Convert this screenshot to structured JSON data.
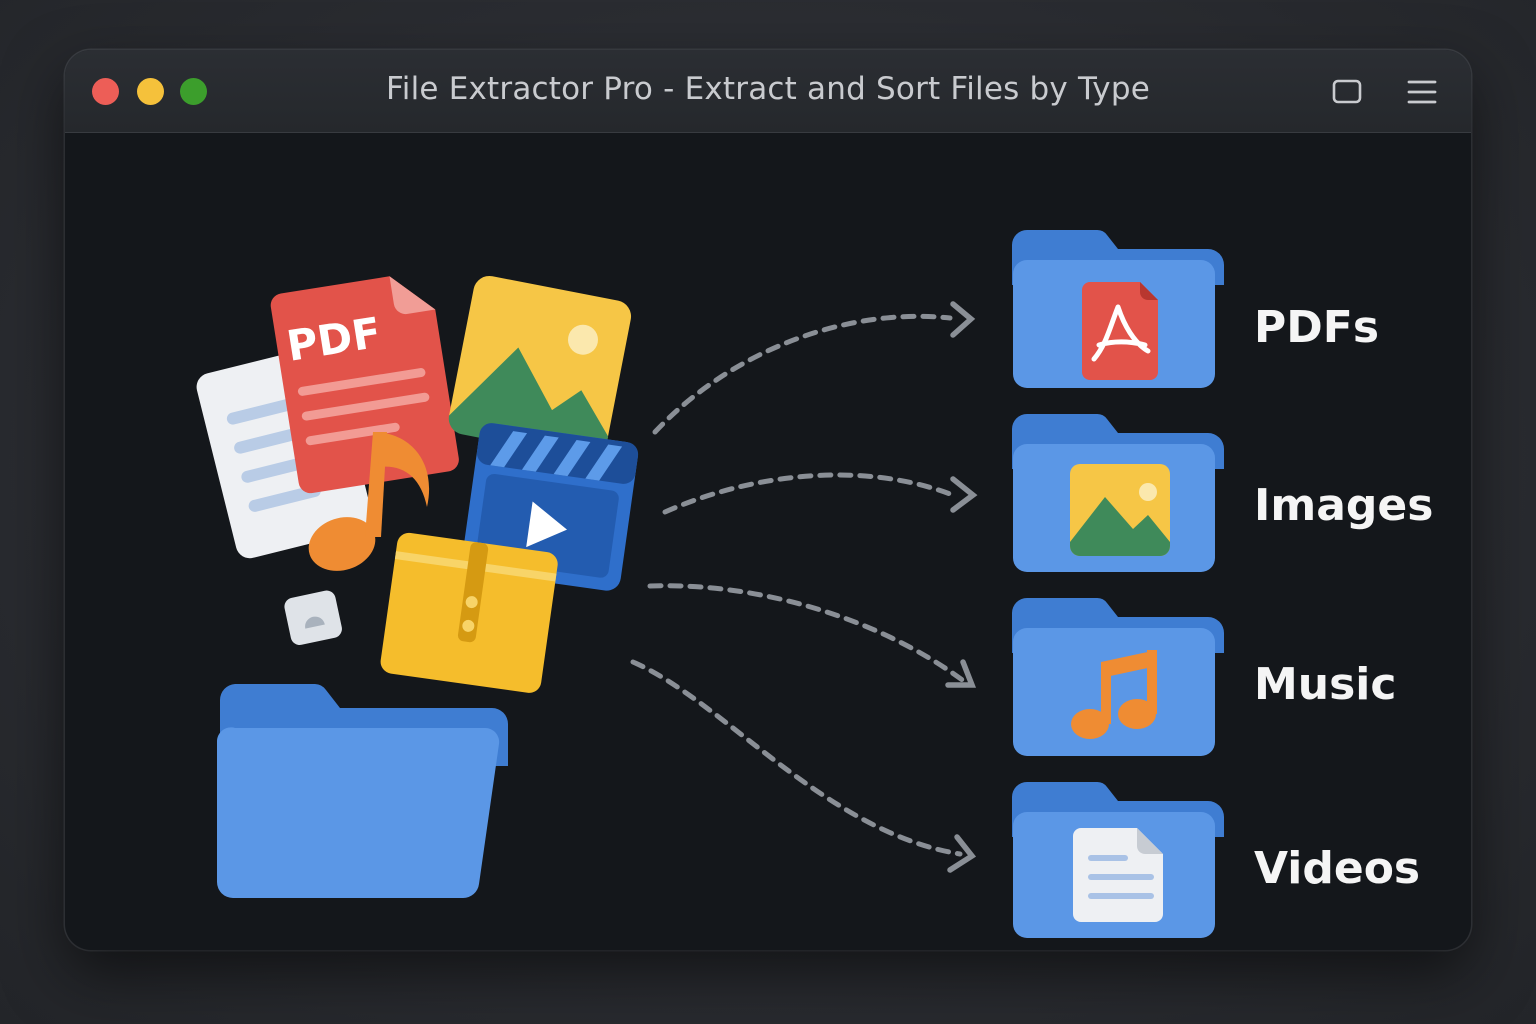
{
  "window": {
    "title": "File Extractor Pro - Extract and Sort Files by Type",
    "traffic_lights": {
      "close": "#ed5e57",
      "minimize": "#f5c13b",
      "zoom": "#3c9e2c"
    },
    "controls": [
      {
        "name": "window-toggle-icon"
      },
      {
        "name": "menu-icon"
      }
    ]
  },
  "source": {
    "scattered_files": [
      {
        "type": "pdf",
        "icon": "pdf-file-icon",
        "label": "PDF",
        "color": "#e2534a"
      },
      {
        "type": "image",
        "icon": "image-file-icon",
        "color": "#f6c646"
      },
      {
        "type": "video",
        "icon": "video-clapper-icon",
        "color": "#2f6fcb"
      },
      {
        "type": "music",
        "icon": "music-note-icon",
        "color": "#ef8c33"
      },
      {
        "type": "document",
        "icon": "text-document-icon",
        "color": "#eef0f3"
      },
      {
        "type": "archive",
        "icon": "zip-archive-icon",
        "color": "#f5bd2c"
      },
      {
        "type": "unknown",
        "icon": "small-file-icon",
        "color": "#dfe3e8"
      }
    ],
    "folder_icon": "source-folder-icon",
    "folder_color": "#5b97e6"
  },
  "destinations": [
    {
      "label": "PDFs",
      "icon": "pdf-icon",
      "accent": "#e2534a"
    },
    {
      "label": "Images",
      "icon": "image-icon",
      "accent": "#f6c646"
    },
    {
      "label": "Music",
      "icon": "music-note-icon",
      "accent": "#ef8c33"
    },
    {
      "label": "Videos",
      "icon": "document-icon",
      "accent": "#eef0f3"
    }
  ],
  "colors": {
    "background": "#14171b",
    "titlebar": "#2b2e33",
    "folder_back": "#3f7dd2",
    "folder_front": "#5b97e6",
    "arrow": "#8a8f96",
    "label": "#f5f5f5"
  }
}
